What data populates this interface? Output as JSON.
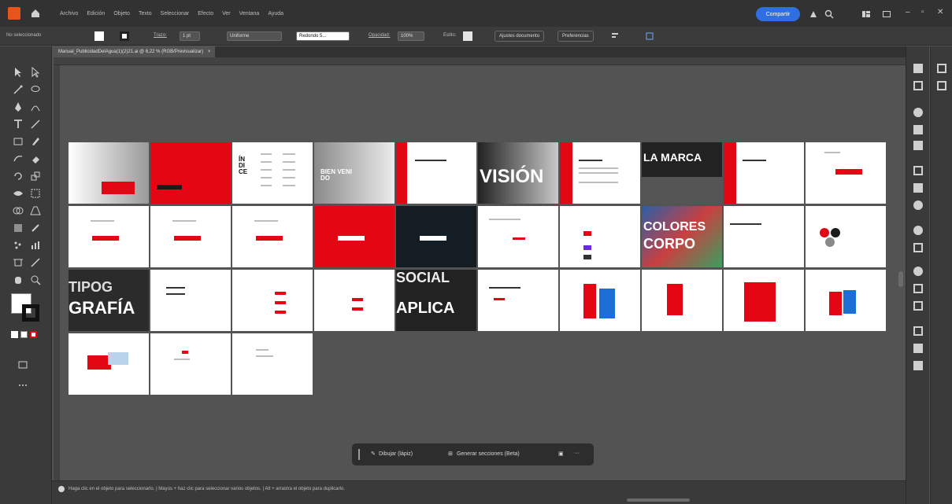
{
  "menubar": {
    "items": [
      "Archivo",
      "Edición",
      "Objeto",
      "Texto",
      "Seleccionar",
      "Efecto",
      "Ver",
      "Ventana",
      "Ayuda"
    ],
    "share_label": "Compartir"
  },
  "control": {
    "selection_label": "No seleccionado",
    "stroke_label": "Trazo:",
    "stroke_value": "1 pt",
    "stroke_style": "Uniforme",
    "brush_label": "Redondo 5...",
    "opacity_label": "Opacidad:",
    "opacity_value": "100%",
    "style_label": "Estilo:",
    "doc_setup": "Ajustes documento",
    "prefs": "Preferencias"
  },
  "document": {
    "tab_title": "Manual_PublicidadDelAgua(1)(2)21.ai @ 6,22 % (RGB/Previsualizar)",
    "close_glyph": "×"
  },
  "artboards": {
    "indice": "ÍN DI CE",
    "bienvenido": "BIEN VENI DO",
    "vision": "VISIÓN",
    "marca": "LA MARCA",
    "colores": "COLORES",
    "corpo": "CORPO",
    "tipo": "TIPOG",
    "grafia": "GRAFÍA",
    "social": "SOCIAL",
    "aplica": "APLICA",
    "brand_tag": "PUBLICIDAD"
  },
  "taskbar": {
    "draw_label": "Dibujar (lápiz)",
    "sections_label": "Generar secciones (Beta)",
    "more": "···"
  },
  "status": {
    "hint": "Haga clic en el objeto para seleccionarlo. | Mayús + haz clic para seleccionar varios objetos. | Alt + arrastra el objeto para duplicarlo."
  },
  "colors": {
    "brand_red": "#e30613",
    "share_blue": "#2f6fe0",
    "ui_dark": "#323232",
    "canvas_gray": "#535353"
  },
  "icons": [
    "home-icon",
    "search-icon",
    "workspace-icon",
    "minimize-icon",
    "maximize-icon",
    "close-icon",
    "pencil-icon",
    "sections-icon"
  ]
}
